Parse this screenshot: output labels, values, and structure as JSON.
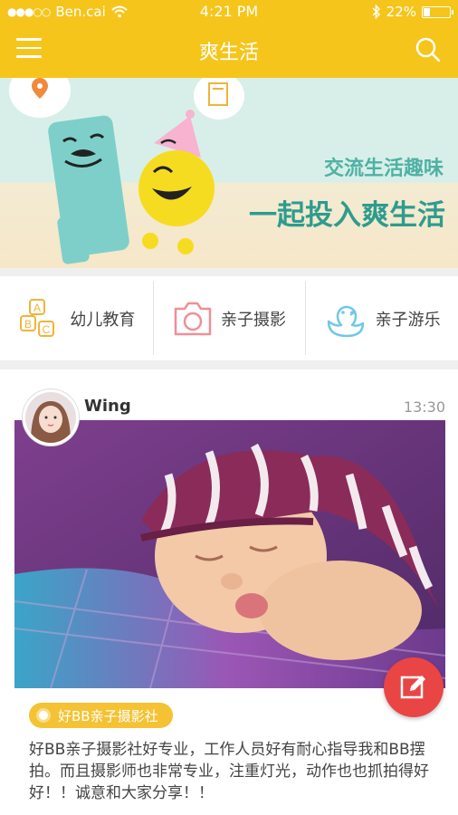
{
  "status_bar": {
    "carrier": "Ben.cai",
    "time": "4:21 PM",
    "battery_percent": "22%",
    "battery_level": 0.22,
    "icons": [
      "signal-dots-icon",
      "wifi-icon",
      "bluetooth-icon",
      "battery-icon"
    ]
  },
  "nav": {
    "title": "爽生活",
    "menu_icon": "hamburger-menu-icon",
    "search_icon": "search-icon"
  },
  "banner": {
    "line1": "交流生活趣味",
    "line2": "一起投入爽生活"
  },
  "categories": [
    {
      "label": "幼儿教育",
      "icon": "abc-blocks-icon"
    },
    {
      "label": "亲子摄影",
      "icon": "camera-icon"
    },
    {
      "label": "亲子游乐",
      "icon": "duck-icon"
    }
  ],
  "post": {
    "username": "Wing",
    "time": "13:30",
    "tag": "好BB亲子摄影社",
    "text": "好BB亲子摄影社好专业，工作人员好有耐心指导我和BB摆拍。而且摄影师也非常专业，注重灯光，动作也也抓拍得好好！！诚意和大家分享！！"
  },
  "fab": {
    "icon": "edit-icon"
  },
  "colors": {
    "brand_yellow": "#f6c51b",
    "banner_teal": "#2d9c8e",
    "fab_red": "#e94545",
    "tag_yellow": "#f4c233"
  }
}
